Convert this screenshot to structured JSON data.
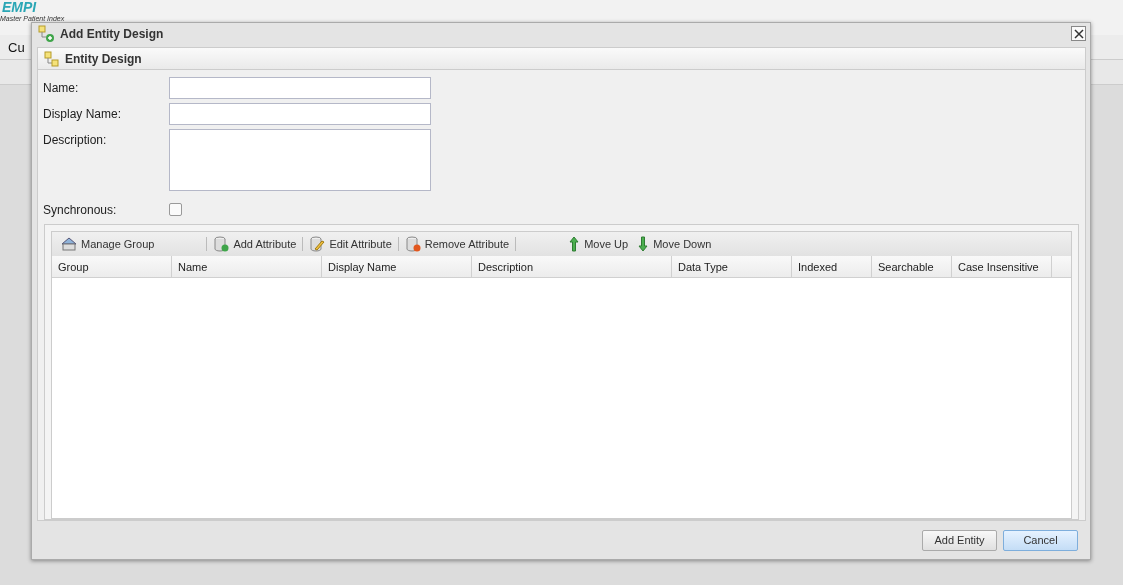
{
  "app": {
    "logo": "EMPI",
    "tagline": "Master Patient Index",
    "menu_visible": "Cu"
  },
  "dialog": {
    "title": "Add Entity Design",
    "panel_title": "Entity Design",
    "fields": [
      {
        "label": "Name:",
        "kind": "text"
      },
      {
        "label": "Display Name:",
        "kind": "text"
      },
      {
        "label": "Description:",
        "kind": "textarea"
      },
      {
        "label": "Synchronous:",
        "kind": "checkbox",
        "checked": false
      }
    ],
    "toolbar": [
      {
        "label": "Manage Group",
        "kind": "group"
      },
      {
        "label": "Add Attribute",
        "kind": "add"
      },
      {
        "label": "Edit Attribute",
        "kind": "edit"
      },
      {
        "label": "Remove Attribute",
        "kind": "remove"
      },
      {
        "label": "Move Up",
        "kind": "up"
      },
      {
        "label": "Move Down",
        "kind": "down"
      }
    ],
    "columns": [
      "Group",
      "Name",
      "Display Name",
      "Description",
      "Data Type",
      "Indexed",
      "Searchable",
      "Case Insensitive"
    ],
    "buttons": [
      {
        "label": "Add Entity",
        "selected": false
      },
      {
        "label": "Cancel",
        "selected": true
      }
    ]
  }
}
